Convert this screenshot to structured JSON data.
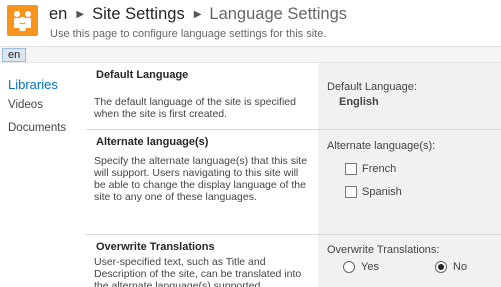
{
  "header": {
    "breadcrumb": {
      "site": "en",
      "section": "Site Settings",
      "page": "Language Settings"
    },
    "description": "Use this page to configure language settings for this site.",
    "logo_icon": "sharepoint-site-icon",
    "logo_color": "#f7941d"
  },
  "language_tab": {
    "label": "en"
  },
  "quick_launch": {
    "items": [
      {
        "label": "Libraries",
        "selected": true
      },
      {
        "label": "Videos",
        "selected": false
      },
      {
        "label": "Documents",
        "selected": false
      }
    ]
  },
  "sections": {
    "default_language": {
      "title": "Default Language",
      "description": "The default language of the site is specified when the site is first created.",
      "field_label": "Default Language:",
      "value": "English"
    },
    "alternate_languages": {
      "title": "Alternate language(s)",
      "description": "Specify the alternate language(s) that this site will support. Users navigating to this site will be able to change the display language of the site to any one of these languages.",
      "field_label": "Alternate language(s):",
      "options": [
        {
          "label": "French",
          "checked": false
        },
        {
          "label": "Spanish",
          "checked": false
        }
      ]
    },
    "overwrite_translations": {
      "title": "Overwrite Translations",
      "description": "User-specified text, such as Title and Description of the site, can be translated into the alternate language(s) supported",
      "field_label": "Overwrite Translations:",
      "options": [
        {
          "label": "Yes",
          "selected": false
        },
        {
          "label": "No",
          "selected": true
        }
      ]
    }
  },
  "colors": {
    "accent": "#0072c6",
    "panel": "#f1f1f1"
  }
}
